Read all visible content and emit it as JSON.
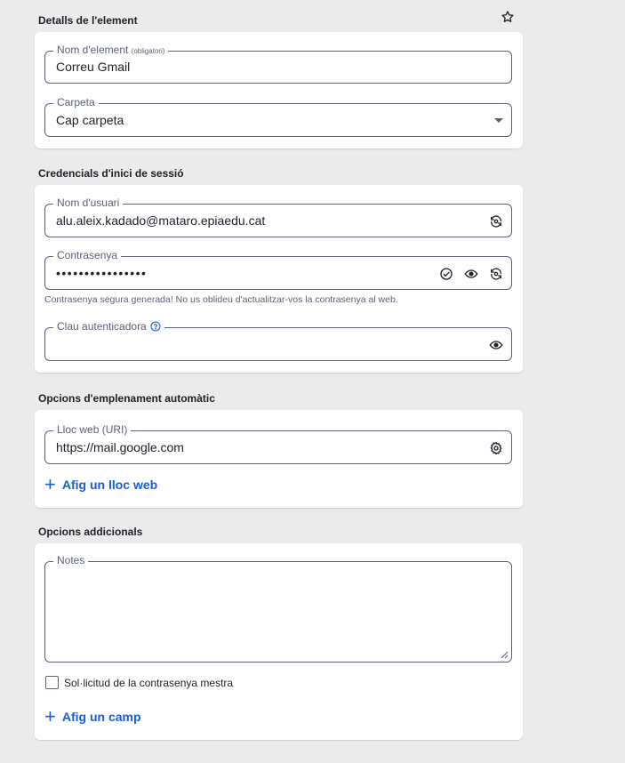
{
  "details": {
    "title": "Detalls de l'element",
    "name_label": "Nom d'element",
    "name_required": "(obligatori)",
    "name_value": "Correu Gmail",
    "folder_label": "Carpeta",
    "folder_value": "Cap carpeta"
  },
  "credentials": {
    "title": "Credencials d'inici de sessió",
    "username_label": "Nom d'usuari",
    "username_value": "alu.aleix.kadado@mataro.epiaedu.cat",
    "password_label": "Contrasenya",
    "password_value": "••••••••••••••••",
    "password_hint": "Contrasenya segura generada! No us oblideu d'actualitzar-vos la contrasenya al web.",
    "totp_label": "Clau autenticadora",
    "totp_value": ""
  },
  "autofill": {
    "title": "Opcions d'emplenament automàtic",
    "uri_label": "Lloc web (URI)",
    "uri_value": "https://mail.google.com",
    "add_website": "Afig un lloc web"
  },
  "additional": {
    "title": "Opcions addicionals",
    "notes_label": "Notes",
    "notes_value": "",
    "reprompt_label": "Sol·licitud de la contrasenya mestra",
    "add_field": "Afig un camp"
  },
  "colors": {
    "accent": "#175ddc",
    "text": "#1b2029",
    "muted": "#5a6275",
    "background": "#ebebeb"
  }
}
